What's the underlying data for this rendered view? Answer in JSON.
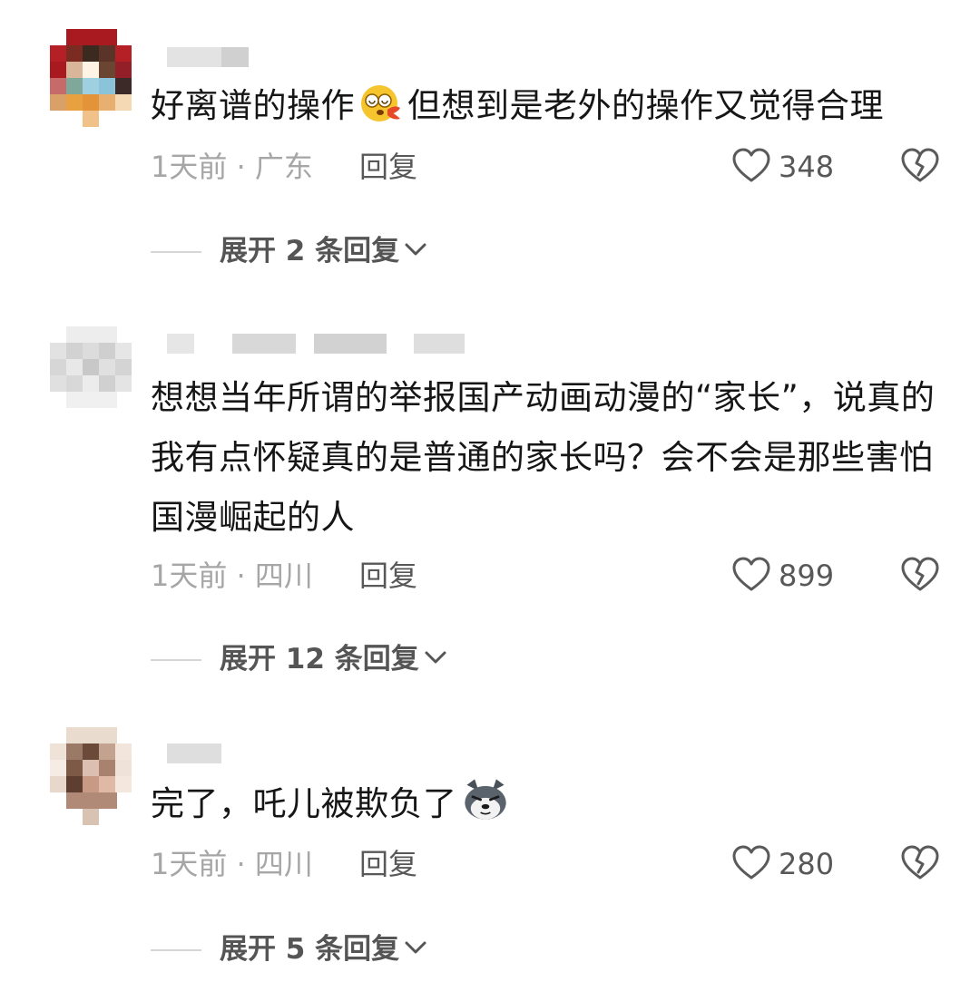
{
  "comments": [
    {
      "text_before_emoji": "好离谱的操作",
      "text_after_emoji": "但想到是老外的操作又觉得合理",
      "emoji_icon": "dizzy-face-emoji-icon",
      "time_location": "1天前 · 广东",
      "reply_label": "回复",
      "likes": "348",
      "expand_label": "展开 2 条回复"
    },
    {
      "text": "想想当年所谓的举报国产动画动漫的“家长”，说真的我有点怀疑真的是普通的家长吗？会不会是那些害怕国漫崛起的人",
      "time_location": "1天前 · 四川",
      "reply_label": "回复",
      "likes": "899",
      "expand_label": "展开 12 条回复"
    },
    {
      "text": "完了，吒儿被欺负了",
      "emoji_icon": "wolf-face-emoji-icon",
      "time_location": "1天前 · 四川",
      "reply_label": "回复",
      "likes": "280",
      "expand_label": "展开 5 条回复"
    }
  ],
  "colors": {
    "text": "#161616",
    "meta": "#a6a6a6",
    "action": "#585858",
    "divider": "#d6d6d6"
  }
}
